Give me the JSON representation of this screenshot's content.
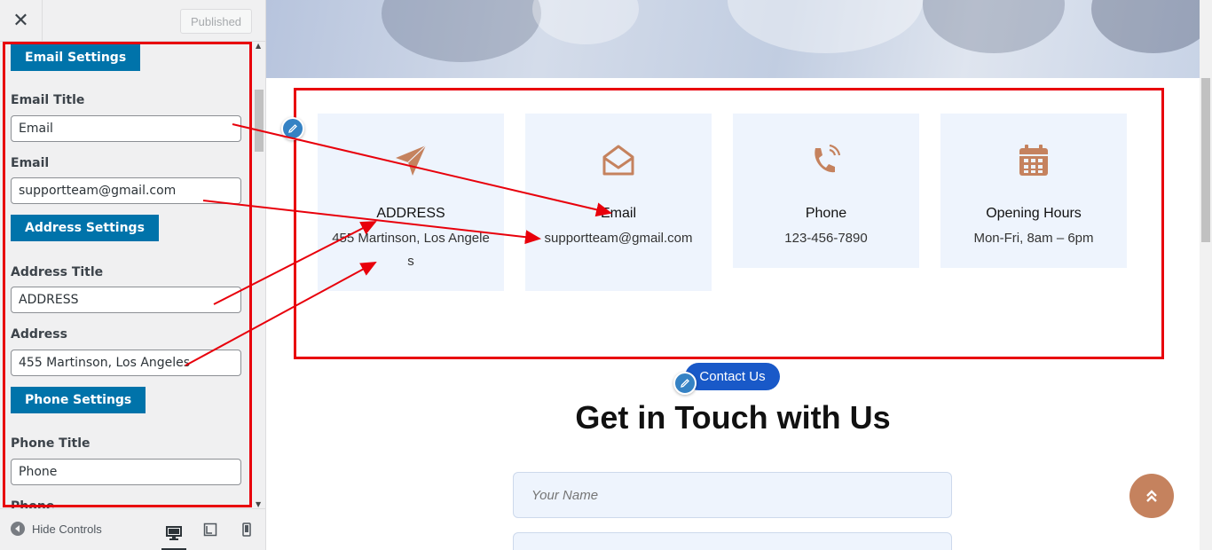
{
  "sidebar": {
    "close_glyph": "✕",
    "published_label": "Published",
    "sections": {
      "email_settings": "Email Settings",
      "address_settings": "Address Settings",
      "phone_settings": "Phone Settings"
    },
    "fields": {
      "email_title": {
        "label": "Email Title",
        "value": "Email"
      },
      "email": {
        "label": "Email",
        "value": "supportteam@gmail.com"
      },
      "address_title": {
        "label": "Address Title",
        "value": "ADDRESS"
      },
      "address": {
        "label": "Address",
        "value": "455 Martinson, Los Angeles"
      },
      "phone_title": {
        "label": "Phone Title",
        "value": "Phone"
      },
      "phone_partial": {
        "label": "Phone"
      }
    },
    "footer": {
      "hide_controls": "Hide Controls",
      "devices": [
        "desktop-icon",
        "tablet-icon",
        "mobile-icon"
      ]
    }
  },
  "preview": {
    "cards": [
      {
        "icon": "paper-plane-icon",
        "title": "ADDRESS",
        "value": "455 Martinson, Los Angeles"
      },
      {
        "icon": "envelope-open-icon",
        "title": "Email",
        "value": "supportteam@gmail.com"
      },
      {
        "icon": "phone-ringing-icon",
        "title": "Phone",
        "value": "123-456-7890"
      },
      {
        "icon": "calendar-icon",
        "title": "Opening Hours",
        "value": "Mon-Fri, 8am – 6pm"
      }
    ],
    "contact_us": "Contact Us",
    "heading": "Get in Touch with Us",
    "name_placeholder": "Your Name"
  },
  "colors": {
    "accent_blue": "#0073aa",
    "highlight_red": "#e8000b",
    "icon_brown": "#c5825e",
    "card_bg": "#eef4fd",
    "pill_blue": "#1959c8"
  }
}
